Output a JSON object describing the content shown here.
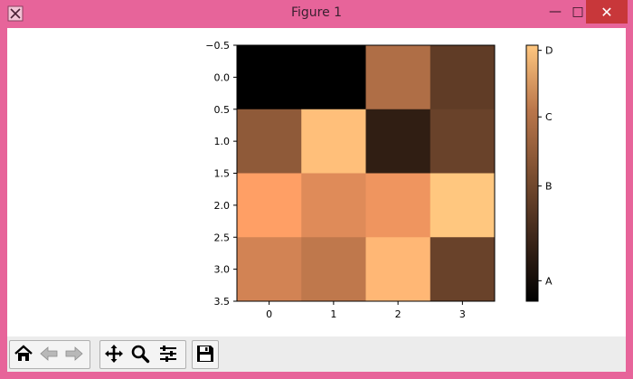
{
  "window": {
    "title": "Figure 1",
    "minimize_glyph": "—",
    "maximize_glyph": "□",
    "close_glyph": "✕"
  },
  "toolbar": {
    "buttons": [
      {
        "name": "home-button",
        "icon": "home-icon"
      },
      {
        "name": "back-button",
        "icon": "arrow-left-icon"
      },
      {
        "name": "forward-button",
        "icon": "arrow-right-icon"
      },
      {
        "name": "pan-button",
        "icon": "move-icon"
      },
      {
        "name": "zoom-button",
        "icon": "magnifier-icon"
      },
      {
        "name": "configure-subplots-button",
        "icon": "sliders-icon"
      },
      {
        "name": "save-button",
        "icon": "floppy-disk-icon"
      }
    ]
  },
  "chart_data": {
    "type": "heatmap",
    "colormap": "copper",
    "x_ticks": [
      "0",
      "1",
      "2",
      "3"
    ],
    "y_ticks": [
      "−0.5",
      "0.0",
      "0.5",
      "1.0",
      "1.5",
      "2.0",
      "2.5",
      "3.0",
      "3.5"
    ],
    "matrix": [
      [
        0.0,
        0.0,
        0.55,
        0.3
      ],
      [
        0.45,
        0.96,
        0.15,
        0.33
      ],
      [
        0.8,
        0.7,
        0.75,
        1.0
      ],
      [
        0.66,
        0.6,
        0.92,
        0.33
      ]
    ],
    "colorbar": {
      "ticks": [
        {
          "label": "A",
          "value": 0.08
        },
        {
          "label": "B",
          "value": 0.45
        },
        {
          "label": "C",
          "value": 0.72
        },
        {
          "label": "D",
          "value": 0.98
        }
      ]
    }
  }
}
